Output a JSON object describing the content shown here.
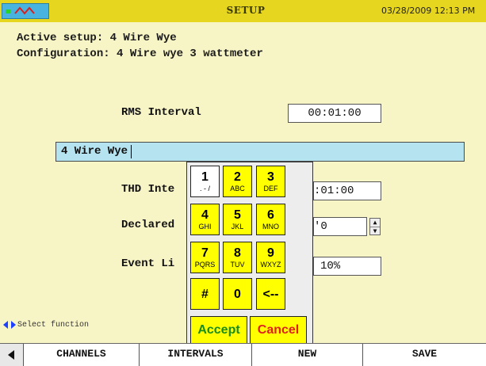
{
  "header": {
    "title": "SETUP",
    "datetime": "03/28/2009 12:13 PM"
  },
  "info": {
    "active_setup": "Active setup: 4 Wire Wye",
    "configuration": "Configuration: 4 Wire wye 3 wattmeter"
  },
  "fields": {
    "rms_label": "RMS Interval",
    "rms_value": "00:01:00",
    "thd_label": "THD Inte",
    "thd_value": ":01:00",
    "declared_label": "Declared",
    "declared_value": "'0",
    "event_label": "Event Li",
    "event_value": "10%"
  },
  "entry": {
    "value": "4 Wire Wye"
  },
  "keypad": {
    "keys": [
      {
        "digit": "1",
        "sub": ". - /"
      },
      {
        "digit": "2",
        "sub": "ABC"
      },
      {
        "digit": "3",
        "sub": "DEF"
      },
      {
        "digit": "4",
        "sub": "GHI"
      },
      {
        "digit": "5",
        "sub": "JKL"
      },
      {
        "digit": "6",
        "sub": "MNO"
      },
      {
        "digit": "7",
        "sub": "PQRS"
      },
      {
        "digit": "8",
        "sub": "TUV"
      },
      {
        "digit": "9",
        "sub": "WXYZ"
      },
      {
        "digit": "#",
        "sub": ""
      },
      {
        "digit": "0",
        "sub": ""
      },
      {
        "digit": "<--",
        "sub": ""
      }
    ],
    "accept": "Accept",
    "cancel": "Cancel"
  },
  "hint": "Select function",
  "bottom": {
    "buttons": [
      "CHANNELS",
      "INTERVALS",
      "NEW",
      "SAVE"
    ]
  },
  "colors": {
    "titlebar": "#e6d61f",
    "background": "#f7f4c6",
    "key": "#ffff00",
    "accept": "#1a8c1a",
    "cancel": "#e02020",
    "entry": "#b5e3f0"
  },
  "icons": {
    "logo": "waveform-logo-icon",
    "hint": "left-right-arrows-icon",
    "back": "back-arrow-icon"
  }
}
